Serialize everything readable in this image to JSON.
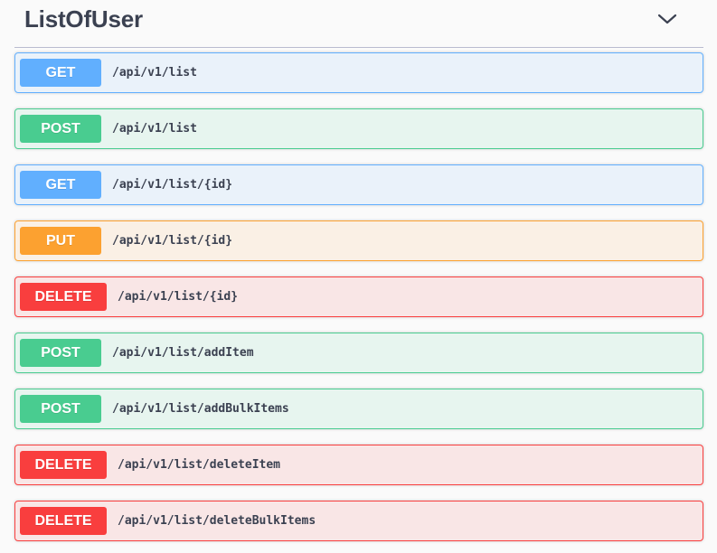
{
  "section": {
    "title": "ListOfUser",
    "toggle_icon": "chevron-down-icon"
  },
  "colors": {
    "get": "#61affe",
    "post": "#49cc90",
    "put": "#fca130",
    "delete": "#f93e3e",
    "text": "#3b4151"
  },
  "operations": [
    {
      "method": "GET",
      "path": "/api/v1/list"
    },
    {
      "method": "POST",
      "path": "/api/v1/list"
    },
    {
      "method": "GET",
      "path": "/api/v1/list/{id}"
    },
    {
      "method": "PUT",
      "path": "/api/v1/list/{id}"
    },
    {
      "method": "DELETE",
      "path": "/api/v1/list/{id}"
    },
    {
      "method": "POST",
      "path": "/api/v1/list/addItem"
    },
    {
      "method": "POST",
      "path": "/api/v1/list/addBulkItems"
    },
    {
      "method": "DELETE",
      "path": "/api/v1/list/deleteItem"
    },
    {
      "method": "DELETE",
      "path": "/api/v1/list/deleteBulkItems"
    }
  ]
}
